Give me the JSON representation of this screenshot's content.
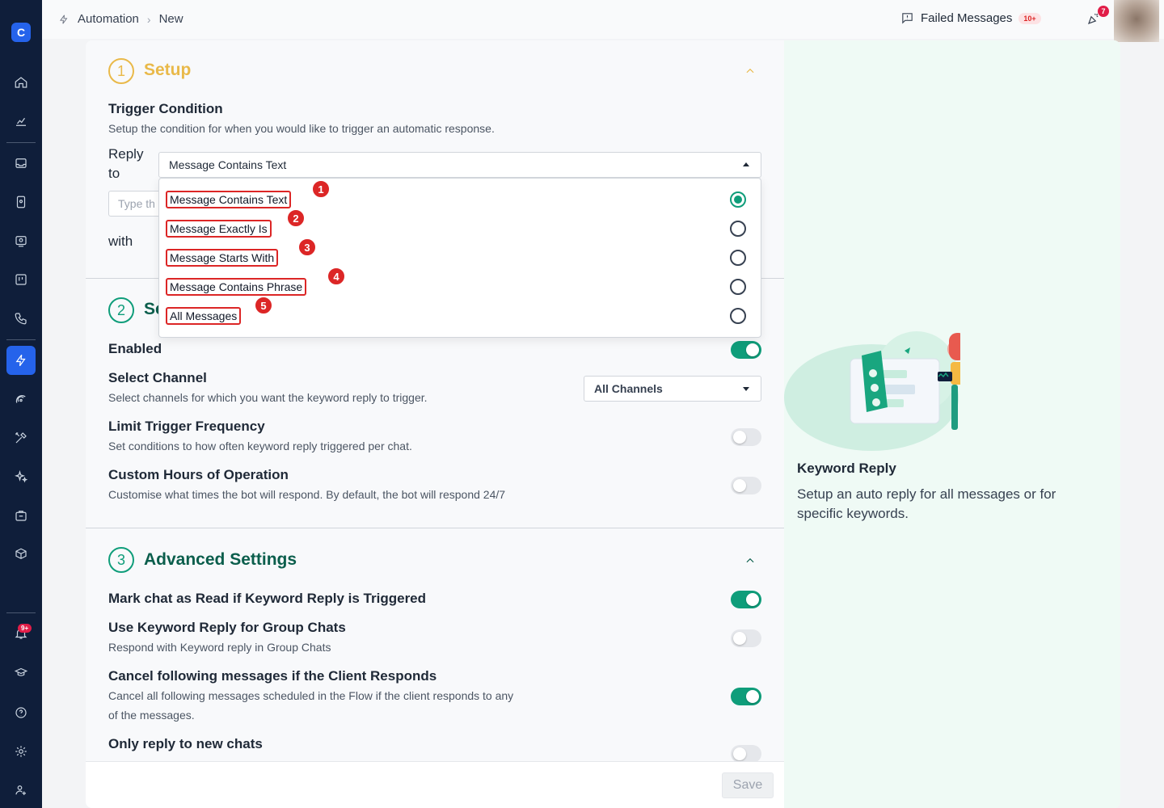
{
  "breadcrumb": {
    "root": "Automation",
    "current": "New"
  },
  "topbar": {
    "failed_label": "Failed Messages",
    "failed_badge": "10+",
    "notif_badge": "7"
  },
  "sidebar": {
    "notif_badge": "9+"
  },
  "setup": {
    "step": "1",
    "title": "Setup",
    "trigger_title": "Trigger Condition",
    "trigger_desc": "Setup the condition for when you would like to trigger an automatic response.",
    "reply_label_1": "Reply",
    "reply_label_2": "to",
    "reply_value": "Message Contains Text",
    "input_placeholder": "Type th",
    "with_label": "with"
  },
  "dropdown": {
    "options": [
      {
        "label": "Message Contains Text",
        "num": "1",
        "selected": true
      },
      {
        "label": "Message Exactly Is",
        "num": "2",
        "selected": false
      },
      {
        "label": "Message Starts With",
        "num": "3",
        "selected": false
      },
      {
        "label": "Message Contains Phrase",
        "num": "4",
        "selected": false
      },
      {
        "label": "All Messages",
        "num": "5",
        "selected": false
      }
    ]
  },
  "section2": {
    "step": "2",
    "title_partial": "Se",
    "enabled_label": "Enabled",
    "channel_title": "Select Channel",
    "channel_desc": "Select channels for which you want the keyword reply to trigger.",
    "channel_value": "All Channels",
    "limit_title": "Limit Trigger Frequency",
    "limit_desc": "Set conditions to how often keyword reply triggered per chat.",
    "hours_title": "Custom Hours of Operation",
    "hours_desc": "Customise what times the bot will respond. By default, the bot will respond 24/7"
  },
  "advanced": {
    "step": "3",
    "title": "Advanced Settings",
    "mark_read": "Mark chat as Read if Keyword Reply is Triggered",
    "group_title": "Use Keyword Reply for Group Chats",
    "group_desc": "Respond with Keyword reply in Group Chats",
    "cancel_title": "Cancel following messages if the Client Responds",
    "cancel_desc_1": "Cancel all following messages scheduled in the Flow if the client responds to any",
    "cancel_desc_2": "of the messages.",
    "only_new": "Only reply to new chats"
  },
  "footer": {
    "save_label": "Save"
  },
  "aside": {
    "title": "Keyword Reply",
    "desc": "Setup an auto reply for all messages or for specific keywords."
  },
  "colors": {
    "accent": "#0f9d7a",
    "setup_accent": "#e9b949",
    "advanced_accent": "#0b5e4c",
    "sidebar": "#0f1e3a",
    "highlight": "#dc2626"
  }
}
